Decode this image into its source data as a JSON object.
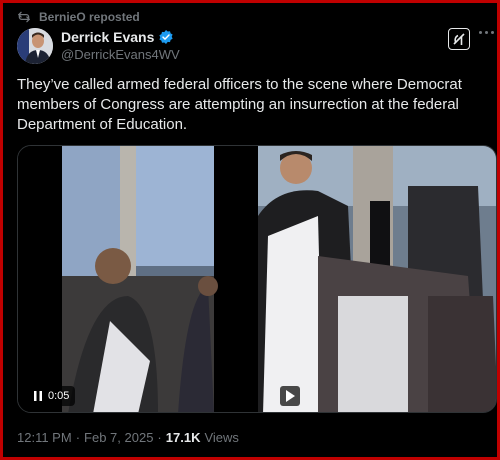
{
  "repost": {
    "text": "BernieO reposted",
    "icon": "repost-icon"
  },
  "author": {
    "name": "Derrick Evans",
    "handle": "@DerrickEvans4WV",
    "verified_color": "#1d9bf0"
  },
  "tweet": {
    "text": "They’ve called armed federal officers to the scene where Democrat members of Congress are attempting an insurrection at the federal Department of Education."
  },
  "media": {
    "duration": "0:05",
    "pause_icon": "pause-icon",
    "play_icon": "play-icon"
  },
  "meta": {
    "time": "12:11 PM",
    "separator": "·",
    "date": "Feb 7, 2025",
    "views_count": "17.1K",
    "views_label": "Views"
  },
  "colors": {
    "background": "#000000",
    "text": "#e7e9ea",
    "muted": "#71767b",
    "border": "#c00000"
  }
}
